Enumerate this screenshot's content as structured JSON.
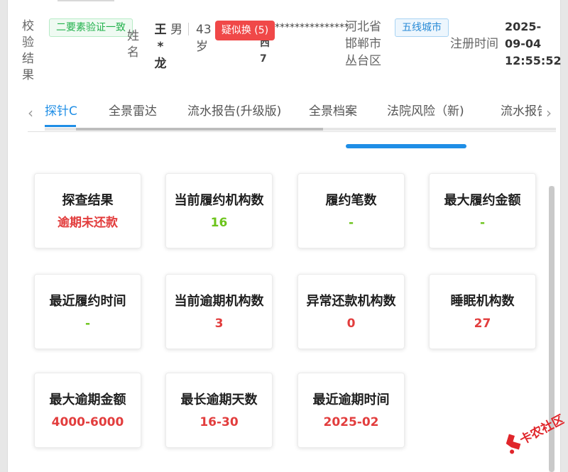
{
  "header": {
    "verify_label": "校验结果",
    "verify_tag": "二要素验证一致",
    "name_label": "姓名",
    "name_value": "王*龙",
    "gender": "男",
    "age": "43岁",
    "risk_tag": "疑似换 (5)",
    "id_masked": "******************",
    "id_chars": [
      "西",
      "7"
    ],
    "location": "河北省邯郸市丛台区",
    "city_tier_tag": "五线城市",
    "register_label": "注册时间",
    "register_date": "2025-09-04",
    "register_time": "12:55:52"
  },
  "tabs": {
    "items": [
      "探针C",
      "全景雷达",
      "流水报告(升级版)",
      "全景档案",
      "法院风险（新)",
      "流水报告"
    ],
    "active_index": 0
  },
  "cards": [
    {
      "label": "探查结果",
      "value": "逾期未还款",
      "color": "#e23d3d"
    },
    {
      "label": "当前履约机构数",
      "value": "16",
      "color": "#6cc41b"
    },
    {
      "label": "履约笔数",
      "value": "-",
      "color": "#6cc41b"
    },
    {
      "label": "最大履约金额",
      "value": "-",
      "color": "#6cc41b"
    },
    {
      "label": "最近履约时间",
      "value": "-",
      "color": "#6cc41b"
    },
    {
      "label": "当前逾期机构数",
      "value": "3",
      "color": "#e23d3d"
    },
    {
      "label": "异常还款机构数",
      "value": "0",
      "color": "#e23d3d"
    },
    {
      "label": "睡眠机构数",
      "value": "27",
      "color": "#e23d3d"
    },
    {
      "label": "最大逾期金额",
      "value": "4000-6000",
      "color": "#e23d3d"
    },
    {
      "label": "最长逾期天数",
      "value": "16-30",
      "color": "#e23d3d"
    },
    {
      "label": "最近逾期时间",
      "value": "2025-02",
      "color": "#e23d3d"
    }
  ],
  "watermark": {
    "text": "卡农社区"
  }
}
